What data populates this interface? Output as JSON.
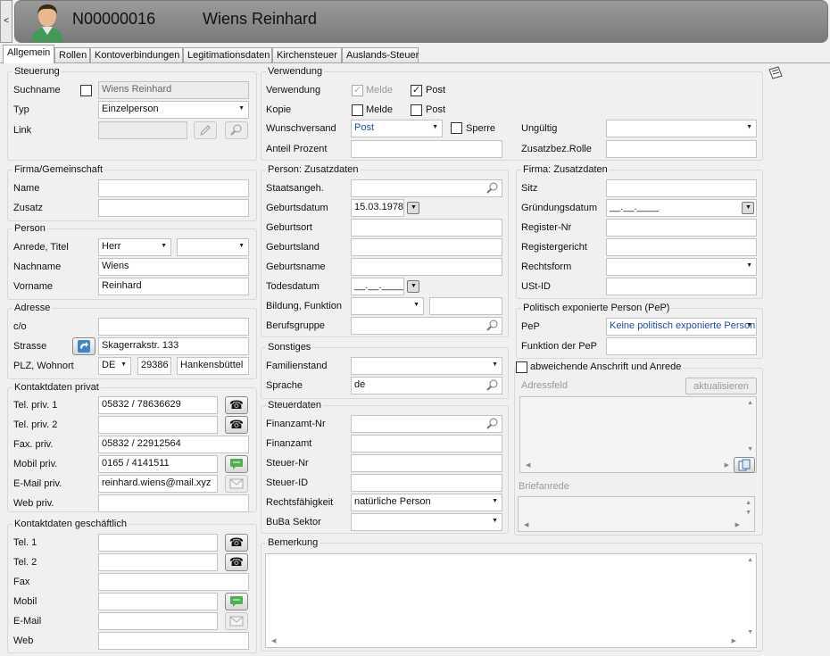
{
  "header": {
    "collapse": "<",
    "id": "N00000016",
    "name": "Wiens Reinhard"
  },
  "tabs": [
    "Allgemein",
    "Rollen",
    "Kontoverbindungen",
    "Legitimationsdaten",
    "Kirchensteuer",
    "Auslands-Steuer"
  ],
  "steuerung": {
    "title": "Steuerung",
    "suchname_label": "Suchname",
    "suchname_value": "Wiens Reinhard",
    "typ_label": "Typ",
    "typ_value": "Einzelperson",
    "link_label": "Link"
  },
  "firma_gem": {
    "title": "Firma/Gemeinschaft",
    "name_label": "Name",
    "zusatz_label": "Zusatz"
  },
  "person": {
    "title": "Person",
    "anrede_label": "Anrede, Titel",
    "anrede_value": "Herr",
    "nachname_label": "Nachname",
    "nachname_value": "Wiens",
    "vorname_label": "Vorname",
    "vorname_value": "Reinhard"
  },
  "adresse": {
    "title": "Adresse",
    "co_label": "c/o",
    "strasse_label": "Strasse",
    "strasse_value": "Skagerrakstr. 133",
    "plz_label": "PLZ, Wohnort",
    "land": "DE",
    "plz": "29386",
    "ort": "Hankensbüttel"
  },
  "kontakt_privat": {
    "title": "Kontaktdaten privat",
    "tel1_label": "Tel. priv. 1",
    "tel1_value": "05832 / 78636629",
    "tel2_label": "Tel. priv. 2",
    "fax_label": "Fax. priv.",
    "fax_value": "05832 / 22912564",
    "mobil_label": "Mobil priv.",
    "mobil_value": "0165 / 4141511",
    "email_label": "E-Mail priv.",
    "email_value": "reinhard.wiens@mail.xyz",
    "web_label": "Web priv."
  },
  "kontakt_gesch": {
    "title": "Kontaktdaten geschäftlich",
    "tel1_label": "Tel. 1",
    "tel2_label": "Tel. 2",
    "fax_label": "Fax",
    "mobil_label": "Mobil",
    "email_label": "E-Mail",
    "web_label": "Web"
  },
  "verwendung": {
    "title": "Verwendung",
    "verwendung_label": "Verwendung",
    "melde": "Melde",
    "post": "Post",
    "kopie_label": "Kopie",
    "wunschversand_label": "Wunschversand",
    "wunschversand_value": "Post",
    "sperre": "Sperre",
    "anteil_label": "Anteil Prozent",
    "ungueltig_label": "Ungültig",
    "zusatzbez_label": "Zusatzbez.Rolle"
  },
  "person_zusatz": {
    "title": "Person: Zusatzdaten",
    "staatsangeh_label": "Staatsangeh.",
    "geburtsdatum_label": "Geburtsdatum",
    "geburtsdatum_value": "15.03.1978",
    "geburtsort_label": "Geburtsort",
    "geburtsland_label": "Geburtsland",
    "geburtsname_label": "Geburtsname",
    "todesdatum_label": "Todesdatum",
    "todesdatum_value": "__.__.____",
    "bildung_label": "Bildung, Funktion",
    "berufsgruppe_label": "Berufsgruppe"
  },
  "firma_zusatz": {
    "title": "Firma: Zusatzdaten",
    "sitz_label": "Sitz",
    "gruendung_label": "Gründungsdatum",
    "gruendung_value": "__.__.____",
    "register_nr_label": "Register-Nr",
    "registergericht_label": "Registergericht",
    "rechtsform_label": "Rechtsform",
    "ustid_label": "USt-ID"
  },
  "pep": {
    "title": "Politisch exponierte Person (PeP)",
    "pep_label": "PeP",
    "pep_value": "Keine politisch exponierte Person",
    "funktion_label": "Funktion der PeP"
  },
  "sonstiges": {
    "title": "Sonstiges",
    "familienstand_label": "Familienstand",
    "sprache_label": "Sprache",
    "sprache_value": "de"
  },
  "steuerdaten": {
    "title": "Steuerdaten",
    "finanzamt_nr_label": "Finanzamt-Nr",
    "finanzamt_label": "Finanzamt",
    "steuer_nr_label": "Steuer-Nr",
    "steuer_id_label": "Steuer-ID",
    "rechtsfaehigkeit_label": "Rechtsfähigkeit",
    "rechtsfaehigkeit_value": "natürliche Person",
    "buba_label": "BuBa Sektor"
  },
  "anschrift": {
    "checkbox_label": "abweichende Anschrift und Anrede",
    "adressfeld_label": "Adressfeld",
    "aktualisieren": "aktualisieren",
    "briefanrede_label": "Briefanrede"
  },
  "bemerkung": {
    "title": "Bemerkung"
  }
}
